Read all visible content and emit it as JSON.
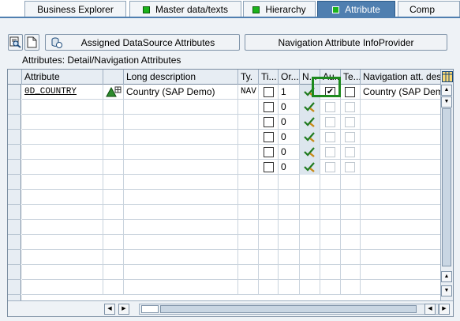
{
  "tabs": [
    {
      "label": "Business Explorer",
      "has_led": false,
      "active": false
    },
    {
      "label": "Master data/texts",
      "has_led": true,
      "active": false
    },
    {
      "label": "Hierarchy",
      "has_led": true,
      "active": false
    },
    {
      "label": "Attribute",
      "has_led": true,
      "active": true
    },
    {
      "label": "Comp",
      "has_led": false,
      "active": false
    }
  ],
  "toolbar": {
    "assigned_ds_label": "Assigned DataSource Attributes",
    "nav_infoprovider_label": "Navigation Attribute InfoProvider"
  },
  "section_title": "Attributes: Detail/Navigation Attributes",
  "grid": {
    "columns": [
      "Attribute",
      "",
      "Long description",
      "Ty.",
      "Ti...",
      "Or...",
      "N...",
      "Au...",
      "Te...",
      "Navigation att. description"
    ],
    "rows": [
      {
        "attribute": "0D_COUNTRY",
        "long_description": "Country (SAP Demo)",
        "type": "NAV",
        "time_dep": false,
        "order": "1",
        "nav": true,
        "auth": true,
        "text": false,
        "nav_desc": "Country (SAP Demo)"
      },
      {
        "attribute": "",
        "long_description": "",
        "type": "",
        "time_dep": false,
        "order": "0",
        "nav": true,
        "auth": false,
        "text": false,
        "nav_desc": ""
      },
      {
        "attribute": "",
        "long_description": "",
        "type": "",
        "time_dep": false,
        "order": "0",
        "nav": true,
        "auth": false,
        "text": false,
        "nav_desc": ""
      },
      {
        "attribute": "",
        "long_description": "",
        "type": "",
        "time_dep": false,
        "order": "0",
        "nav": true,
        "auth": false,
        "text": false,
        "nav_desc": ""
      },
      {
        "attribute": "",
        "long_description": "",
        "type": "",
        "time_dep": false,
        "order": "0",
        "nav": true,
        "auth": false,
        "text": false,
        "nav_desc": ""
      },
      {
        "attribute": "",
        "long_description": "",
        "type": "",
        "time_dep": false,
        "order": "0",
        "nav": true,
        "auth": false,
        "text": false,
        "nav_desc": ""
      }
    ]
  },
  "colors": {
    "active_tab": "#4f7fb0",
    "led_green": "#1bb31b",
    "highlight": "#1d8a1d"
  }
}
